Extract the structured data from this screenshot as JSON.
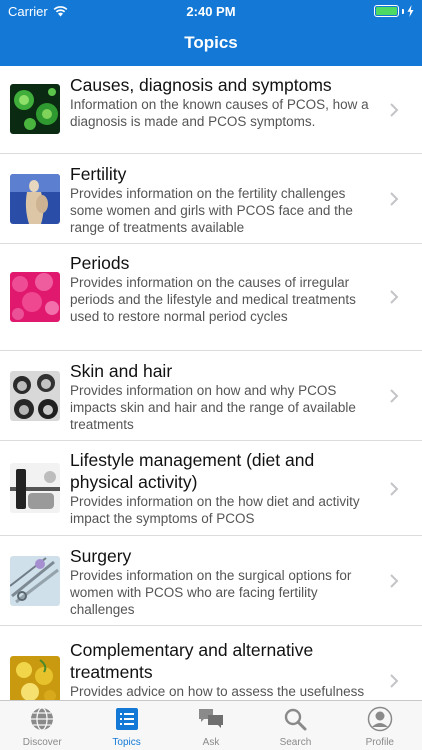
{
  "status_bar": {
    "carrier": "Carrier",
    "time": "2:40 PM"
  },
  "header": {
    "title": "Topics"
  },
  "topics": [
    {
      "title": "Causes, diagnosis and symptoms",
      "description": "Information on the known causes of PCOS, how a diagnosis is made and PCOS symptoms."
    },
    {
      "title": "Fertility",
      "description": "Provides information on the fertility challenges some women and girls with PCOS face and the range of treatments available"
    },
    {
      "title": "Periods",
      "description": "Provides information on the causes of irregular periods and the lifestyle and medical treatments used to restore normal period cycles"
    },
    {
      "title": "Skin and hair",
      "description": "Provides information on how and why PCOS impacts skin and hair and the range of available treatments"
    },
    {
      "title": "Lifestyle management (diet and physical activity)",
      "description": "Provides information on the how diet and activity impact the symptoms of PCOS"
    },
    {
      "title": "Surgery",
      "description": "Provides information on the surgical options for women with PCOS who are facing fertility challenges"
    },
    {
      "title": "Complementary and alternative treatments",
      "description": "Provides advice on how to assess the usefulness and safety of PCOS related"
    }
  ],
  "tabs": [
    {
      "label": "Discover",
      "icon": "globe-icon"
    },
    {
      "label": "Topics",
      "icon": "list-icon"
    },
    {
      "label": "Ask",
      "icon": "chat-bubbles-icon"
    },
    {
      "label": "Search",
      "icon": "magnifier-icon"
    },
    {
      "label": "Profile",
      "icon": "person-icon"
    }
  ],
  "colors": {
    "accent": "#1479d6",
    "battery": "#4cd964",
    "tab_inactive": "#8a8a8a"
  }
}
